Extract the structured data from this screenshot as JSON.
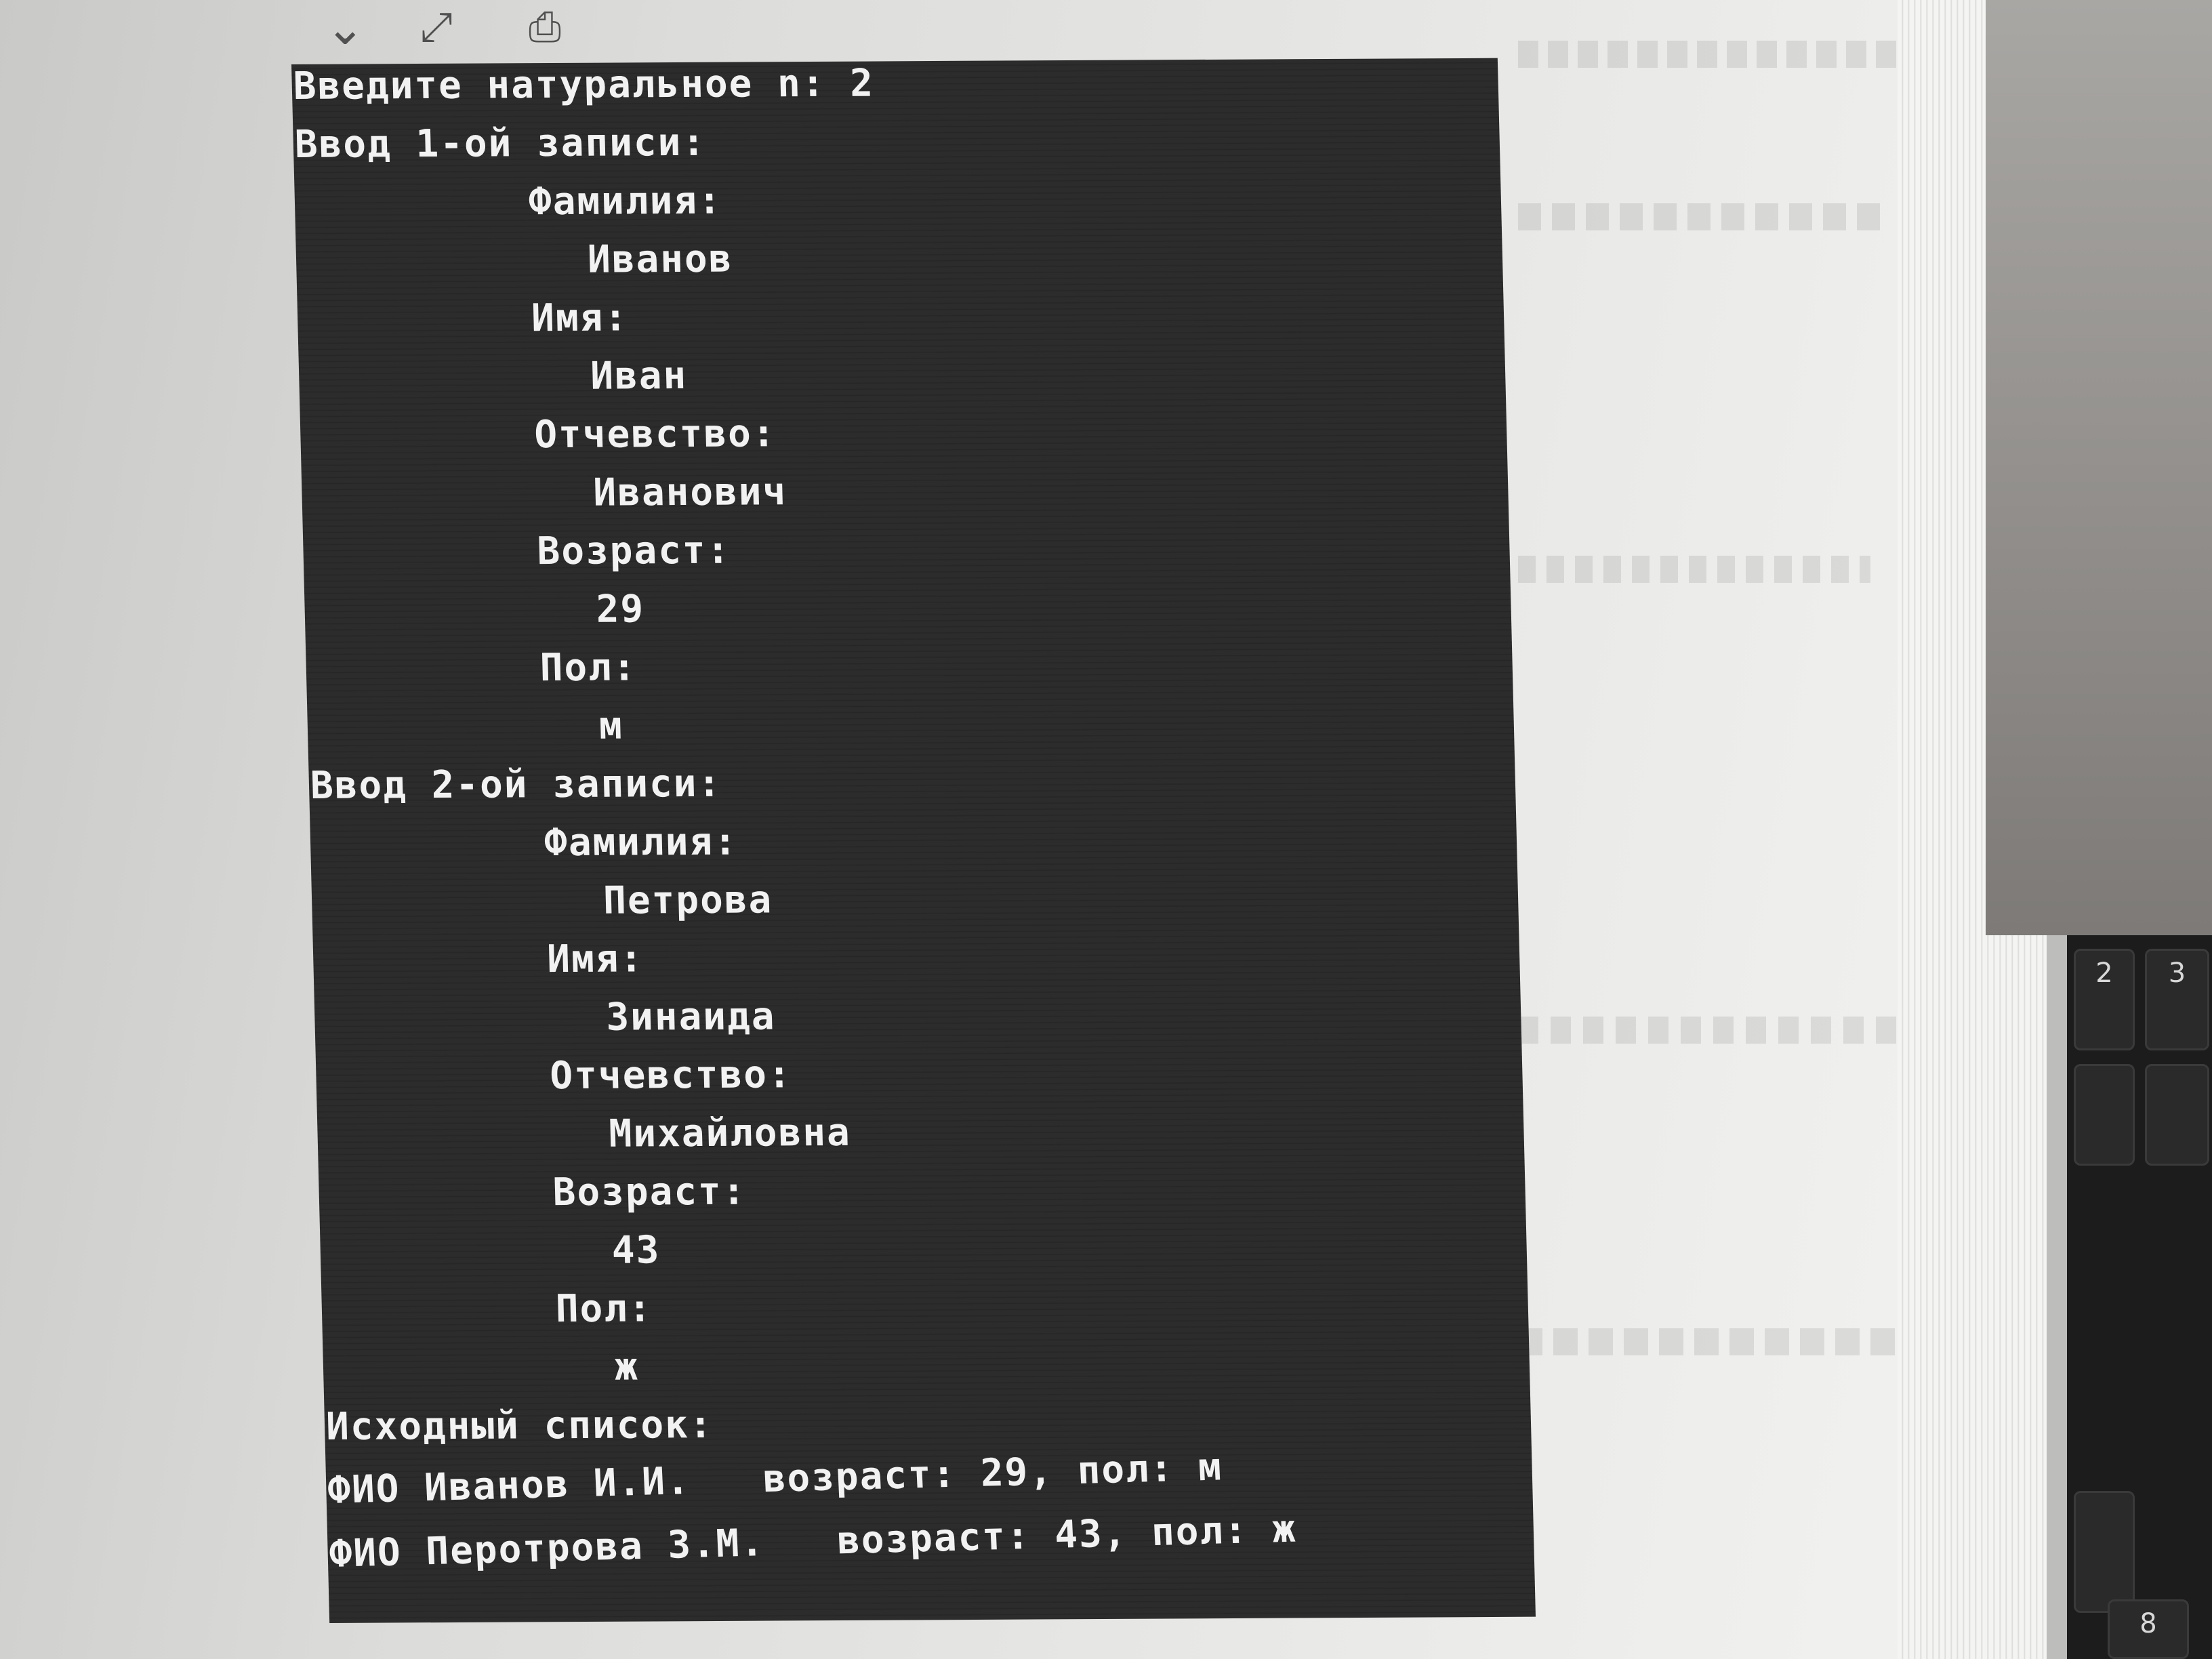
{
  "toolbar": {
    "icons": [
      "chevron-down-icon",
      "expand-arrows-icon",
      "save-icon"
    ]
  },
  "console": {
    "prompt_n": "Введите натуральное n: 2",
    "entry1_header": "Ввод 1-ой записи:",
    "entry1": {
      "surname_label": "Фамилия:",
      "surname_value": "Иванов",
      "name_label": "Имя:",
      "name_value": "Иван",
      "patronymic_label": "Отчевство:",
      "patronymic_value": "Иванович",
      "age_label": "Возраст:",
      "age_value": "29",
      "sex_label": "Пол:",
      "sex_value": "м"
    },
    "entry2_header": "Ввод 2-ой записи:",
    "entry2": {
      "surname_label": "Фамилия:",
      "surname_value": "Петрова",
      "name_label": "Имя:",
      "name_value": "Зинаида",
      "patronymic_label": "Отчевство:",
      "patronymic_value": "Михайловна",
      "age_label": "Возраст:",
      "age_value": "43",
      "sex_label": "Пол:",
      "sex_value": "ж"
    },
    "list_header": "Исходный список:",
    "list_rows": [
      "ФИО Иванов И.И.   возраст: 29, пол: м",
      "ФИО Перотрова З.М.   возраст: 43, пол: ж"
    ]
  },
  "keyboard": {
    "keys": [
      "2",
      "3",
      "8"
    ]
  }
}
